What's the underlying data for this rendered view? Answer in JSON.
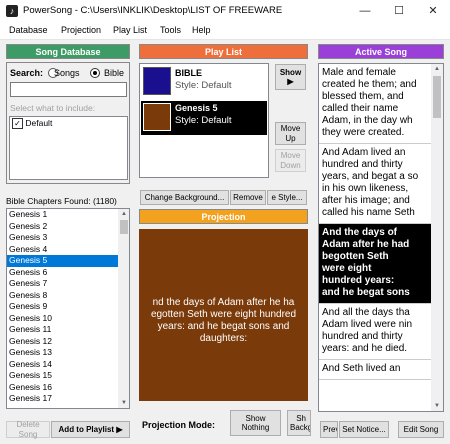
{
  "window": {
    "title": "PowerSong - C:\\Users\\INKLIK\\Desktop\\LIST OF FREEWARE",
    "icon": "music-note-icon",
    "min_glyph": "—",
    "max_glyph": "☐",
    "close_glyph": "✕"
  },
  "menu": [
    "Database",
    "Projection",
    "Play List",
    "Tools",
    "Help"
  ],
  "song_database": {
    "header": "Song Database",
    "search_label": "Search:",
    "radio_songs": "Songs",
    "radio_bible": "Bible",
    "search_value": "",
    "include_label": "Select what to include:",
    "include_items": [
      {
        "label": "Default",
        "checked": true
      }
    ],
    "chapters_label": "Bible Chapters Found: (1180)",
    "chapters": [
      "Genesis 1",
      "Genesis 2",
      "Genesis 3",
      "Genesis 4",
      "Genesis 5",
      "Genesis 6",
      "Genesis 7",
      "Genesis 8",
      "Genesis 9",
      "Genesis 10",
      "Genesis 11",
      "Genesis 12",
      "Genesis 13",
      "Genesis 14",
      "Genesis 15",
      "Genesis 16",
      "Genesis 17"
    ],
    "selected_chapter": "Genesis 5",
    "delete_label": "Delete Song",
    "add_label": "Add to Playlist ▶"
  },
  "play_list": {
    "header": "Play List",
    "items": [
      {
        "title": "BIBLE",
        "style": "Style: Default",
        "swatch": "#1a0f8f",
        "selected": false
      },
      {
        "title": "Genesis 5",
        "style": "Style: Default",
        "swatch": "#7a3a0a",
        "selected": true
      }
    ],
    "show_label": "Show",
    "show_arrow": "▶",
    "move_up_label": "Move Up",
    "move_down_label": "Move Down",
    "change_bg_label": "Change Background...",
    "remove_label": "Remove",
    "style_label": "e Style..."
  },
  "projection": {
    "header": "Projection",
    "bg_color": "#7a3a0a",
    "text_lines": [
      "nd the days of Adam after he ha",
      "egotten Seth were eight hundred",
      "years: and he begat sons and",
      "daughters:"
    ],
    "mode_label": "Projection Mode:",
    "show_nothing_label": "Show Nothing",
    "show_back_label": "Sh Backg"
  },
  "active_song": {
    "header": "Active Song",
    "verses": [
      {
        "lines": [
          "Male and female",
          "created he them; and",
          "blessed them, and",
          "called their name",
          "Adam, in the day wh",
          "they were created."
        ],
        "highlight": false
      },
      {
        "lines": [
          "And Adam lived an",
          "hundred and thirty",
          "years, and begat a so",
          "in his own likeness,",
          "after his image; and",
          "called his name Seth"
        ],
        "highlight": false
      },
      {
        "lines": [
          "And the days of",
          "Adam after he had",
          "begotten Seth",
          "were eight",
          "hundred years:",
          "and he begat sons"
        ],
        "highlight": true
      },
      {
        "lines": [
          "And all the days tha",
          "Adam lived were nin",
          "hundred and thirty",
          "years: and he died."
        ],
        "highlight": false
      },
      {
        "lines": [
          "And Seth lived an"
        ],
        "highlight": false
      }
    ],
    "prev_label": "Prev",
    "set_notice_label": "Set Notice...",
    "edit_song_label": "Edit Song"
  },
  "colors": {
    "green": "#3d9b65",
    "orange": "#ef6f3c",
    "purple": "#9b3fd9",
    "gold": "#f3a21f",
    "selection": "#0078d7"
  }
}
